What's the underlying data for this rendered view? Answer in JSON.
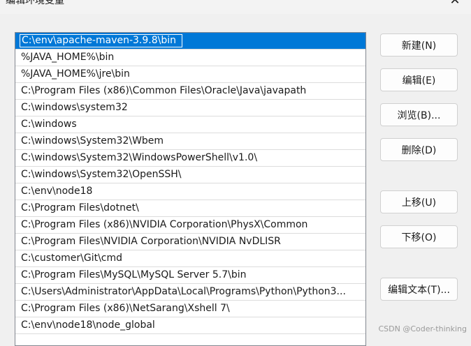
{
  "window": {
    "title": "编辑环境变量",
    "close_symbol": "✕"
  },
  "path_list": {
    "items": [
      {
        "label": "C:\\env\\apache-maven-3.9.8\\bin",
        "selected": true
      },
      {
        "label": "%JAVA_HOME%\\bin"
      },
      {
        "label": "%JAVA_HOME%\\jre\\bin"
      },
      {
        "label": "C:\\Program Files (x86)\\Common Files\\Oracle\\Java\\javapath"
      },
      {
        "label": "C:\\windows\\system32"
      },
      {
        "label": "C:\\windows"
      },
      {
        "label": "C:\\windows\\System32\\Wbem"
      },
      {
        "label": "C:\\windows\\System32\\WindowsPowerShell\\v1.0\\"
      },
      {
        "label": "C:\\windows\\System32\\OpenSSH\\"
      },
      {
        "label": "C:\\env\\node18"
      },
      {
        "label": "C:\\Program Files\\dotnet\\"
      },
      {
        "label": "C:\\Program Files (x86)\\NVIDIA Corporation\\PhysX\\Common"
      },
      {
        "label": "C:\\Program Files\\NVIDIA Corporation\\NVIDIA NvDLISR"
      },
      {
        "label": "C:\\customer\\Git\\cmd"
      },
      {
        "label": "C:\\Program Files\\MySQL\\MySQL Server 5.7\\bin"
      },
      {
        "label": "C:\\Users\\Administrator\\AppData\\Local\\Programs\\Python\\Python3..."
      },
      {
        "label": "C:\\Program Files (x86)\\NetSarang\\Xshell 7\\"
      },
      {
        "label": "C:\\env\\node18\\node_global"
      }
    ]
  },
  "buttons": {
    "new": "新建(N)",
    "edit": "编辑(E)",
    "browse": "浏览(B)...",
    "delete": "删除(D)",
    "move_up": "上移(U)",
    "move_down": "下移(O)",
    "edit_text": "编辑文本(T)..."
  },
  "watermark": "CSDN @Coder-thinking",
  "colors": {
    "selection": "#0078d7",
    "background": "#f0f0f0"
  }
}
